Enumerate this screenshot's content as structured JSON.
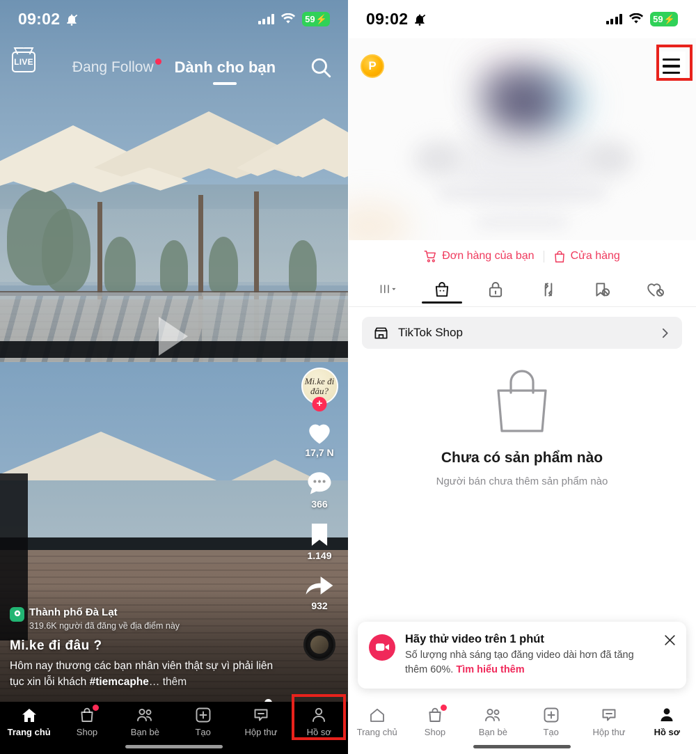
{
  "left_screen": {
    "status_bar": {
      "time": "09:02",
      "mute_icon": "bell-slash-icon",
      "battery": "59",
      "battery_charging": true
    },
    "top_nav": {
      "live_label": "LIVE",
      "tabs": [
        {
          "label": "Đang Follow",
          "active": false,
          "has_dot": true
        },
        {
          "label": "Dành cho bạn",
          "active": true,
          "has_dot": false
        }
      ],
      "search_icon": "search-icon"
    },
    "action_rail": {
      "avatar_text": "Mi.ke đi đâu?",
      "follow_badge": "+",
      "items": [
        {
          "icon": "heart-icon",
          "count": "17,7 N"
        },
        {
          "icon": "comment-icon",
          "count": "366"
        },
        {
          "icon": "bookmark-icon",
          "count": "1.149"
        },
        {
          "icon": "share-icon",
          "count": "932"
        }
      ]
    },
    "caption": {
      "location_name": "Thành phố Đà Lạt",
      "location_sub": "319.6K người đã đăng về địa điểm này",
      "author": "Mi.ke  đi  đâu ?",
      "description_1": "Hôm nay thương các bạn nhân viên thật sự vì",
      "description_2": "phải liên tục xin lỗi khách ",
      "hashtag": "#tiemcaphe",
      "more_label": "… thêm"
    },
    "bottom_nav": [
      {
        "label": "Trang chủ",
        "icon": "home-icon",
        "active": true,
        "badge": false
      },
      {
        "label": "Shop",
        "icon": "shop-bag-icon",
        "active": false,
        "badge": true
      },
      {
        "label": "Bạn bè",
        "icon": "friends-icon",
        "active": false,
        "badge": false
      },
      {
        "label": "Tạo",
        "icon": "plus-box-icon",
        "active": false,
        "badge": false
      },
      {
        "label": "Hộp thư",
        "icon": "inbox-icon",
        "active": false,
        "badge": false
      },
      {
        "label": "Hồ sơ",
        "icon": "person-icon",
        "active": false,
        "badge": false
      }
    ]
  },
  "right_screen": {
    "status_bar": {
      "time": "09:02",
      "mute_icon": "bell-slash-icon",
      "battery": "59",
      "battery_charging": true
    },
    "coin_badge": "P",
    "menu_icon": "hamburger-menu-icon",
    "shop_links": [
      {
        "label": "Đơn hàng của bạn",
        "icon": "cart-icon"
      },
      {
        "label": "Cửa hàng",
        "icon": "storefront-bag-icon"
      }
    ],
    "profile_tabs": [
      {
        "icon": "grid-dropdown-icon",
        "active": false
      },
      {
        "icon": "shop-bag-icon",
        "active": true
      },
      {
        "icon": "lock-icon",
        "active": false
      },
      {
        "icon": "repost-icon",
        "active": false
      },
      {
        "icon": "bookmark-off-icon",
        "active": false
      },
      {
        "icon": "heart-off-icon",
        "active": false
      }
    ],
    "shop_row": {
      "label": "TikTok Shop",
      "icon": "storefront-icon",
      "chevron": "chevron-right-icon"
    },
    "empty_state": {
      "icon": "shopping-bag-icon",
      "title": "Chưa có sản phẩm nào",
      "subtitle": "Người bán chưa thêm sản phẩm nào"
    },
    "toast": {
      "icon": "video-camera-icon",
      "title": "Hãy thử video trên 1 phút",
      "text_1": "Số lượng nhà sáng tạo đăng video dài hơn đã",
      "text_2": "tăng thêm 60%. ",
      "link": "Tìm hiểu thêm",
      "close_icon": "close-icon"
    },
    "bottom_nav": [
      {
        "label": "Trang chủ",
        "icon": "home-icon",
        "active": false,
        "badge": false
      },
      {
        "label": "Shop",
        "icon": "shop-bag-icon",
        "active": false,
        "badge": true
      },
      {
        "label": "Bạn bè",
        "icon": "friends-icon",
        "active": false,
        "badge": false
      },
      {
        "label": "Tạo",
        "icon": "plus-box-icon",
        "active": false,
        "badge": false
      },
      {
        "label": "Hộp thư",
        "icon": "inbox-icon",
        "active": false,
        "badge": false
      },
      {
        "label": "Hồ sơ",
        "icon": "person-icon",
        "active": true,
        "badge": false
      }
    ]
  },
  "annotations": {
    "highlight_color": "#e8221c",
    "highlights": [
      {
        "target": "profile-tab-bottom-nav-left"
      },
      {
        "target": "hamburger-menu-right"
      }
    ]
  },
  "colors": {
    "accent_pink": "#fe2c55",
    "shop_link": "#ef3a5d",
    "battery_green": "#30d158",
    "coin_gold": "#ffb300"
  }
}
